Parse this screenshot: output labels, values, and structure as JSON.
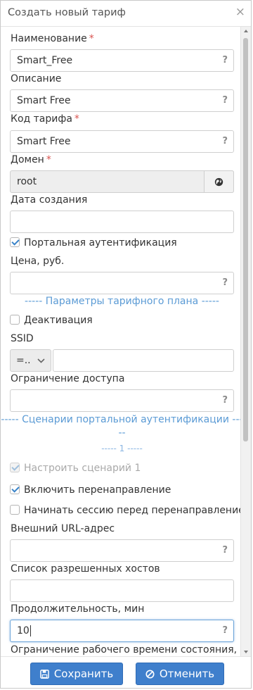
{
  "dialog": {
    "title": "Создать новый тариф",
    "close": "×"
  },
  "fields": {
    "name": {
      "label": "Наименование",
      "required": "*",
      "value": "Smart_Free",
      "hint": "?"
    },
    "description": {
      "label": "Описание",
      "value": "Smart Free",
      "hint": "?"
    },
    "code": {
      "label": "Код тарифа",
      "required": "*",
      "value": "Smart Free",
      "hint": "?"
    },
    "domain": {
      "label": "Домен",
      "required": "*",
      "value": "root",
      "addon_icon": "globe-icon"
    },
    "created": {
      "label": "Дата создания",
      "value": ""
    },
    "portal_auth": {
      "label": "Портальная аутентификация",
      "checked": true
    },
    "price": {
      "label": "Цена, руб.",
      "value": "",
      "hint": "?"
    },
    "tariff_section": "----- Параметры тарифного плана -----",
    "deactivation": {
      "label": "Деактивация",
      "checked": false
    },
    "ssid": {
      "label": "SSID",
      "operator": "=..",
      "value": ""
    },
    "access_limit": {
      "label": "Ограничение доступа",
      "value": "",
      "hint": "?"
    },
    "scenarios_section_line1": "----- Сценарии портальной аутентификации ---",
    "scenarios_section_line2": "--",
    "scenario_index": "----- 1 -----",
    "configure_scenario": {
      "label": "Настроить сценарий 1",
      "checked": true,
      "disabled": true
    },
    "enable_redirect": {
      "label": "Включить перенаправление",
      "checked": true
    },
    "session_before_redirect": {
      "label": "Начинать сессию перед перенаправлением",
      "checked": false
    },
    "external_url": {
      "label": "Внешний URL-адрес",
      "value": "",
      "hint": "?"
    },
    "allowed_hosts": {
      "label": "Список разрешенных хостов",
      "value": ""
    },
    "duration": {
      "label": "Продолжительность, мин",
      "value": "10",
      "hint": "?"
    },
    "worktime_limit": {
      "label": "Ограничение рабочего времени состояния, ми"
    }
  },
  "buttons": {
    "save": {
      "label": "Сохранить",
      "icon": "floppy-icon"
    },
    "cancel": {
      "label": "Отменить",
      "icon": "ban-icon"
    }
  },
  "colors": {
    "accent": "#3f7fcc",
    "section": "#5b9bd5",
    "required": "#d9534f"
  }
}
